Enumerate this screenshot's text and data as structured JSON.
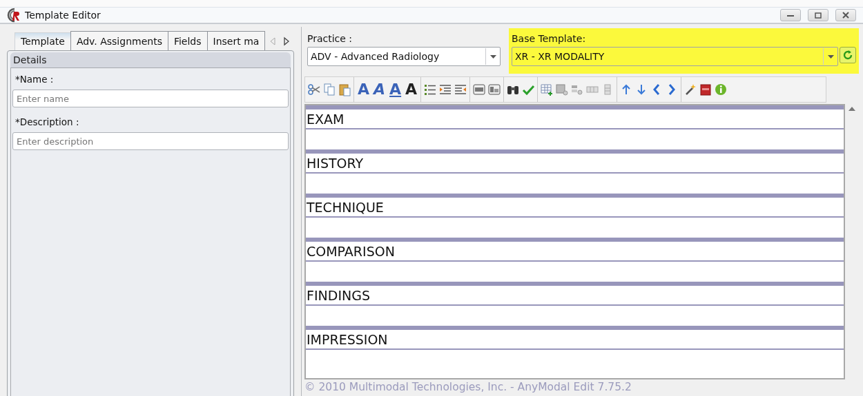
{
  "window": {
    "title": "Template Editor"
  },
  "tabs": [
    {
      "label": "Template",
      "selected": true
    },
    {
      "label": "Adv. Assignments",
      "selected": false
    },
    {
      "label": "Fields",
      "selected": false
    },
    {
      "label": "Insert ma",
      "selected": false
    }
  ],
  "details": {
    "title": "Details",
    "fields": [
      {
        "label": "*Name :",
        "placeholder": "Enter name"
      },
      {
        "label": "*Description :",
        "placeholder": "Enter description"
      }
    ]
  },
  "practice": {
    "label": "Practice :",
    "value": "ADV - Advanced Radiology"
  },
  "base_template": {
    "label": "Base Template:",
    "value": "XR - XR MODALITY"
  },
  "format_buttons": [
    "A",
    "A",
    "A",
    "A"
  ],
  "sections": [
    "EXAM",
    "HISTORY",
    "TECHNIQUE",
    "COMPARISON",
    "FINDINGS",
    "IMPRESSION"
  ],
  "footer": "© 2010 Multimodal Technologies, Inc. - AnyModal Edit 7.75.2"
}
